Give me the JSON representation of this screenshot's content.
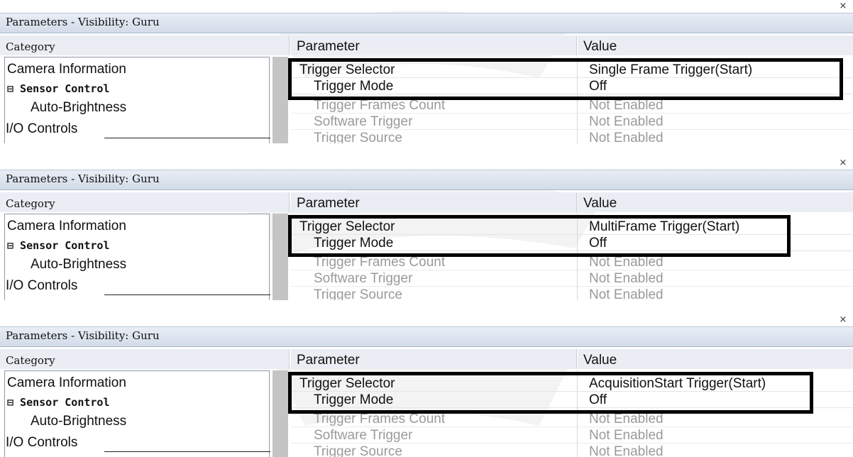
{
  "panels": [
    {
      "title": "Parameters - Visibility: Guru",
      "close_icon": "×",
      "headers": {
        "category": "Category",
        "parameter": "Parameter",
        "value": "Value"
      },
      "categories": {
        "camera": "Camera Information",
        "sensor": "⊟ Sensor Control",
        "auto": "Auto-Brightness",
        "io": "I/O Controls"
      },
      "rows": [
        {
          "parameter": "Trigger Selector",
          "value": "Single Frame Trigger(Start)",
          "enabled": true
        },
        {
          "parameter": "Trigger Mode",
          "value": "Off",
          "enabled": true
        },
        {
          "parameter": "Trigger Frames Count",
          "value": "Not Enabled",
          "enabled": false
        },
        {
          "parameter": "Software Trigger",
          "value": "Not Enabled",
          "enabled": false
        },
        {
          "parameter": "Trigger Source",
          "value": "Not Enabled",
          "enabled": false
        }
      ]
    },
    {
      "title": "Parameters - Visibility: Guru",
      "close_icon": "×",
      "headers": {
        "category": "Category",
        "parameter": "Parameter",
        "value": "Value"
      },
      "categories": {
        "camera": "Camera Information",
        "sensor": "⊟ Sensor Control",
        "auto": "Auto-Brightness",
        "io": "I/O Controls"
      },
      "rows": [
        {
          "parameter": "Trigger Selector",
          "value": "MultiFrame Trigger(Start)",
          "enabled": true
        },
        {
          "parameter": "Trigger Mode",
          "value": "Off",
          "enabled": true
        },
        {
          "parameter": "Trigger Frames Count",
          "value": "Not Enabled",
          "enabled": false
        },
        {
          "parameter": "Software Trigger",
          "value": "Not Enabled",
          "enabled": false
        },
        {
          "parameter": "Trigger Source",
          "value": "Not Enabled",
          "enabled": false
        }
      ]
    },
    {
      "title": "Parameters - Visibility: Guru",
      "close_icon": "×",
      "headers": {
        "category": "Category",
        "parameter": "Parameter",
        "value": "Value"
      },
      "categories": {
        "camera": "Camera Information",
        "sensor": "⊟ Sensor Control",
        "auto": "Auto-Brightness",
        "io": "I/O Controls"
      },
      "rows": [
        {
          "parameter": "Trigger Selector",
          "value": "AcquisitionStart Trigger(Start)",
          "enabled": true
        },
        {
          "parameter": "Trigger Mode",
          "value": "Off",
          "enabled": true
        },
        {
          "parameter": "Trigger Frames Count",
          "value": "Not Enabled",
          "enabled": false
        },
        {
          "parameter": "Software Trigger",
          "value": "Not Enabled",
          "enabled": false
        },
        {
          "parameter": "Trigger Source",
          "value": "Not Enabled",
          "enabled": false
        }
      ]
    }
  ]
}
